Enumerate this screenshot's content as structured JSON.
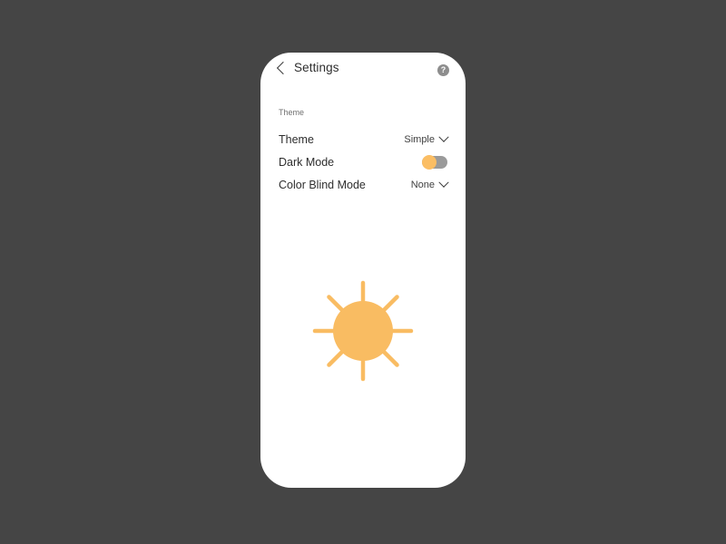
{
  "background": {
    "color": "#454545"
  },
  "phone": {
    "screen_color": "#ffffff"
  },
  "header": {
    "back_icon": "chevron-left-icon",
    "title": "Settings",
    "help_icon": "help-question-icon",
    "help_glyph": "?"
  },
  "settings": {
    "section_label": "Theme",
    "rows": [
      {
        "label": "Theme",
        "type": "select",
        "value": "Simple",
        "icon": "chevron-down-icon"
      },
      {
        "label": "Dark Mode",
        "type": "toggle",
        "value": "off",
        "knob_color": "#fbbe64",
        "track_color": "#9a9a9a"
      },
      {
        "label": "Color Blind Mode",
        "type": "select",
        "value": "None",
        "icon": "chevron-down-icon"
      }
    ]
  },
  "illustration": {
    "icon": "sun-icon",
    "color": "#f9bc62",
    "ray_count": 8
  }
}
